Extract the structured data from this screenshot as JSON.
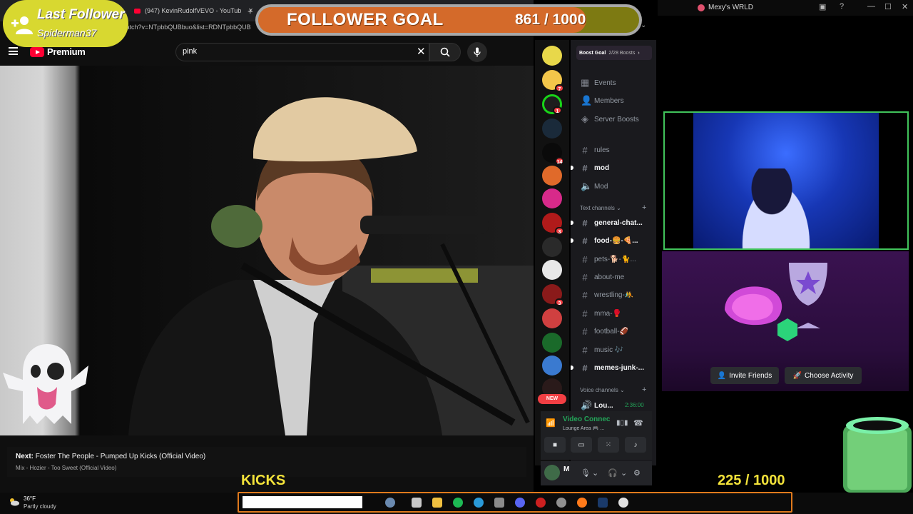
{
  "browser": {
    "tab_label": "(947) KevinRudolfVEVO - YouTub",
    "new_tab": "+",
    "close_tab": "×",
    "address": "watch?v=NTpbbQUBbuo&list=RDNTpbbQUB"
  },
  "youtube": {
    "logo_text": "Premium",
    "search_value": "pink",
    "next_label": "Next:",
    "next_title": "Foster The People - Pumped Up Kicks (Official Video)",
    "mix_subtitle": "Mix - Hozier - Too Sweet (Official Video)"
  },
  "overlay": {
    "last_follower_title": "Last Follower",
    "last_follower_name": "Spiderman37",
    "goal_label": "FOLLOWER GOAL",
    "goal_current": "861",
    "goal_target": "1000",
    "goal_text": "861  /  1000",
    "goal_progress": 0.861,
    "kicks_label": "KICKS",
    "kicks_text": "225  / 1000"
  },
  "discord": {
    "window_title": "Mexy's WRLD",
    "boost_goal_label": "Boost Goal",
    "boost_goal_count": "2/28 Boosts",
    "nav": [
      {
        "label": "Events",
        "icon": "calendar-icon"
      },
      {
        "label": "Members",
        "icon": "members-icon"
      },
      {
        "label": "Server Boosts",
        "icon": "boost-icon"
      }
    ],
    "top_channels": [
      {
        "label": "rules",
        "active": false
      },
      {
        "label": "mod",
        "active": true
      },
      {
        "label": "Mod",
        "active": false
      }
    ],
    "text_category": "Text channels",
    "text_channels": [
      {
        "label": "general-chat...",
        "active": true
      },
      {
        "label": "food-🍔-🍕...",
        "active": true
      },
      {
        "label": "pets-🐕-🐈...",
        "active": false
      },
      {
        "label": "about-me",
        "active": false
      },
      {
        "label": "wrestling-🤼",
        "active": false
      },
      {
        "label": "mma-🥊",
        "active": false
      },
      {
        "label": "football-🏈",
        "active": false
      },
      {
        "label": "music 🎶",
        "active": false
      },
      {
        "label": "memes-junk-...",
        "active": true
      }
    ],
    "voice_category": "Voice channels",
    "voice_channel": "Lou...",
    "voice_timer": "2:36:00",
    "voice_status": "Video Connec",
    "voice_room": "Lounge Area 🎮 ...",
    "new_badge": "NEW",
    "user_initial": "M",
    "badges": [
      "7",
      "1",
      "14",
      "3",
      "3"
    ],
    "invite_label": "Invite Friends",
    "choose_label": "Choose Activity"
  },
  "taskbar": {
    "temperature": "36°F",
    "conditions": "Partly cloudy"
  },
  "colors": {
    "goal_fill": "#d46a2a",
    "follower_bg": "#d8d830",
    "kicks": "#f3e23a",
    "discord_green": "#23a559",
    "taskbar_frame": "#e07a1c"
  }
}
